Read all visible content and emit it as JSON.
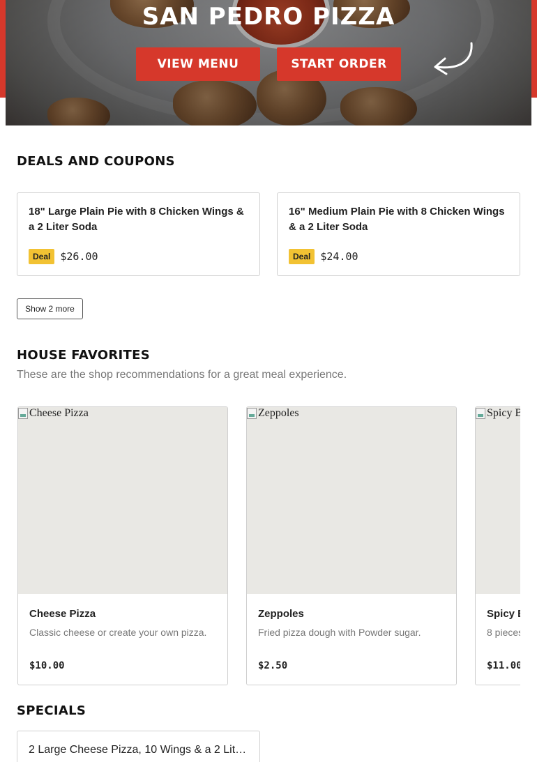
{
  "hero": {
    "title": "SAN PEDRO PIZZA",
    "view_menu_label": "VIEW MENU",
    "start_order_label": "START ORDER",
    "accent_color": "#d6382b"
  },
  "deals": {
    "title": "DEALS AND COUPONS",
    "items": [
      {
        "name": "18\" Large Plain Pie with 8 Chicken Wings & a 2 Liter Soda",
        "badge": "Deal",
        "price": "$26.00"
      },
      {
        "name": "16\" Medium Plain Pie with 8 Chicken Wings & a 2 Liter Soda",
        "badge": "Deal",
        "price": "$24.00"
      }
    ],
    "show_more_label": "Show 2 more",
    "badge_color": "#f2c233"
  },
  "favorites": {
    "title": "HOUSE FAVORITES",
    "subtitle": "These are the shop recommendations for a great meal experience.",
    "items": [
      {
        "image_alt": "Cheese Pizza",
        "name": "Cheese Pizza",
        "description": "Classic cheese or create your own pizza.",
        "price": "$10.00"
      },
      {
        "image_alt": "Zeppoles",
        "name": "Zeppoles",
        "description": "Fried pizza dough with Powder sugar.",
        "price": "$2.50"
      },
      {
        "image_alt": "Spicy B",
        "name": "Spicy B",
        "description": "8 pieces",
        "price": "$11.00"
      }
    ]
  },
  "specials": {
    "title": "SPECIALS",
    "items": [
      {
        "name": "2 Large Cheese Pizza, 10 Wings & a 2 Lite..."
      }
    ]
  }
}
